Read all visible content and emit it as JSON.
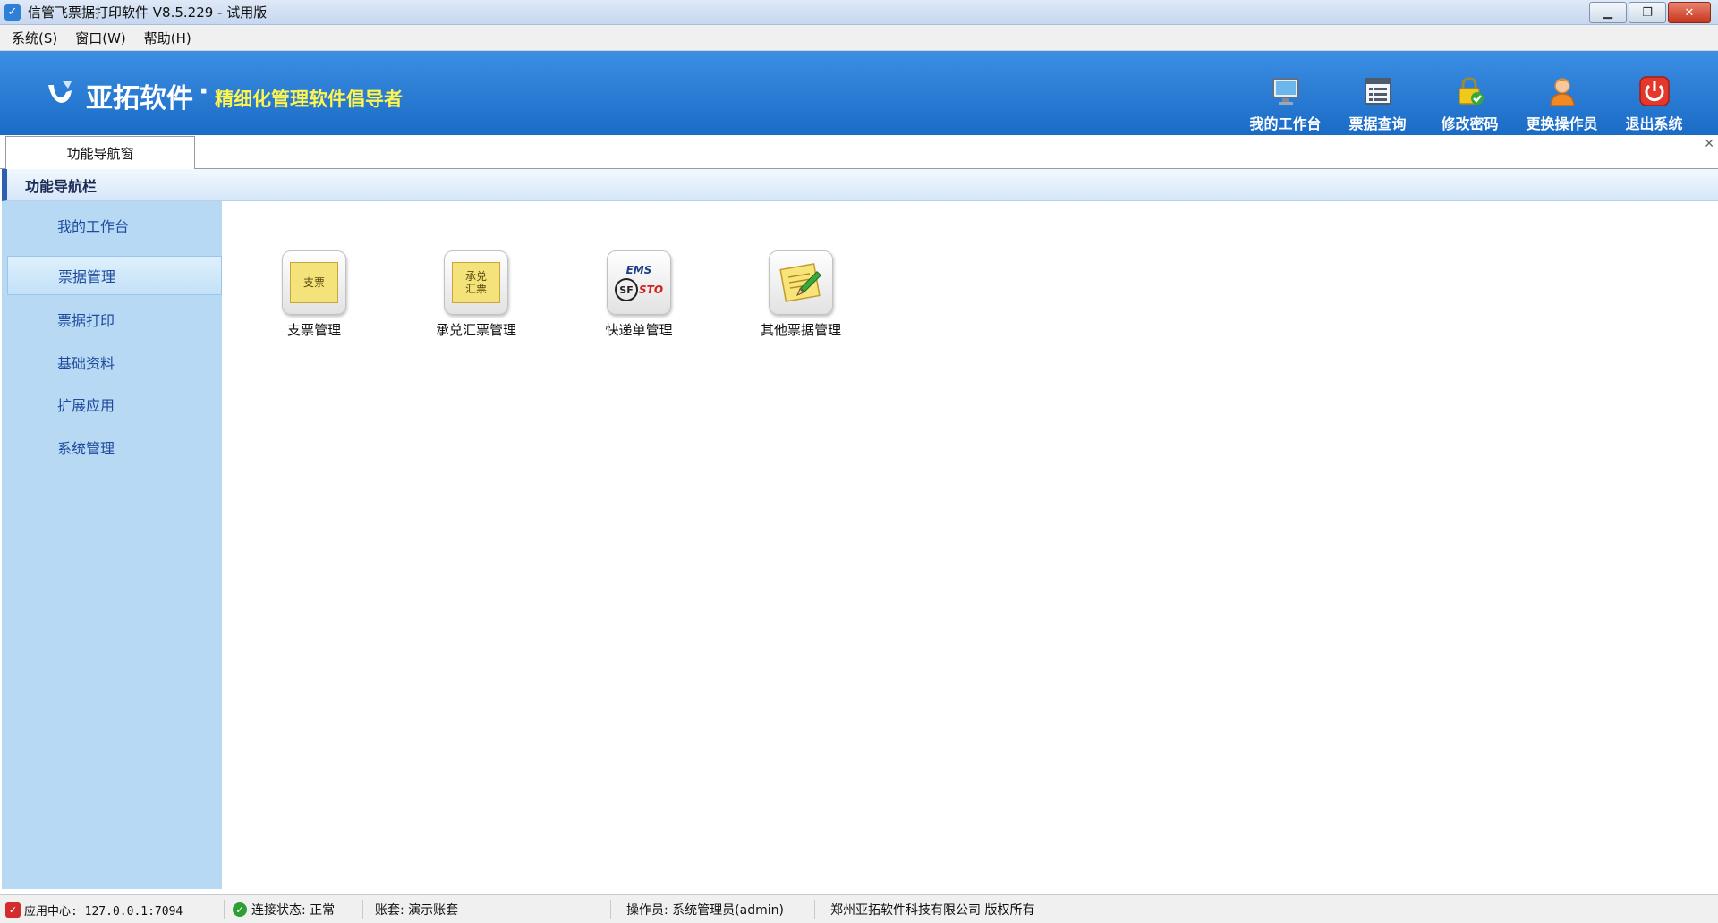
{
  "window": {
    "title": "信管飞票据打印软件 V8.5.229 - 试用版",
    "app_icon": "app-logo-icon",
    "controls": {
      "minimize": "minimize-icon",
      "restore": "restore-icon",
      "close": "close-icon"
    }
  },
  "menubar": {
    "items": [
      {
        "label": "系统(S)"
      },
      {
        "label": "窗口(W)"
      },
      {
        "label": "帮助(H)"
      }
    ]
  },
  "banner": {
    "logo_text": "亚拓软件",
    "dot": "·",
    "slogan": "精细化管理软件倡导者",
    "slogan_color": "#fff54c",
    "background_color": "#1f73cf",
    "toolbar": [
      {
        "label": "我的工作台",
        "icon": "monitor-icon"
      },
      {
        "label": "票据查询",
        "icon": "list-icon"
      },
      {
        "label": "修改密码",
        "icon": "lock-check-icon"
      },
      {
        "label": "更换操作员",
        "icon": "user-icon"
      },
      {
        "label": "退出系统",
        "icon": "power-icon"
      }
    ]
  },
  "tabs": [
    {
      "label": "功能导航窗",
      "active": true
    }
  ],
  "nav": {
    "header": "功能导航栏",
    "items": [
      {
        "label": "我的工作台",
        "active": false
      },
      {
        "label": "票据管理",
        "active": true
      },
      {
        "label": "票据打印",
        "active": false
      },
      {
        "label": "基础资料",
        "active": false
      },
      {
        "label": "扩展应用",
        "active": false
      },
      {
        "label": "系统管理",
        "active": false
      }
    ]
  },
  "modules": [
    {
      "label": "支票管理",
      "icon": "cheque-icon",
      "card_text": "支票"
    },
    {
      "label": "承兑汇票管理",
      "icon": "acceptance-bill-icon",
      "card_text": "承兑\n汇票"
    },
    {
      "label": "快递单管理",
      "icon": "express-icon",
      "ems_text": "EMS",
      "sf_text": "SF",
      "sto_text": "STO"
    },
    {
      "label": "其他票据管理",
      "icon": "notepad-pencil-icon"
    }
  ],
  "statusbar": {
    "app_center": "应用中心: 127.0.0.1:7094",
    "connection": "连接状态: 正常",
    "account": "账套: 演示账套",
    "operator": "操作员: 系统管理员(admin)",
    "copyright": "郑州亚拓软件科技有限公司 版权所有"
  }
}
